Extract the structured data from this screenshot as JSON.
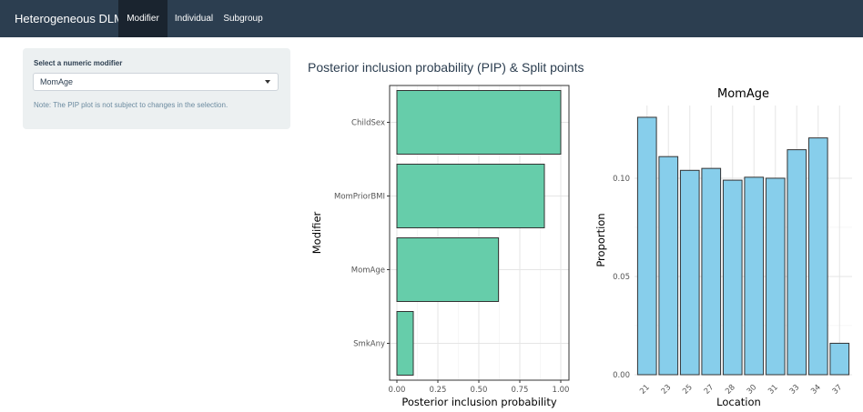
{
  "navbar": {
    "brand": "Heterogeneous DLM",
    "tabs": [
      {
        "label": "Modifier",
        "active": true
      },
      {
        "label": "Individual",
        "active": false
      },
      {
        "label": "Subgroup",
        "active": false
      }
    ]
  },
  "sidebar": {
    "select_label": "Select a numeric modifier",
    "selected_value": "MomAge",
    "note": "Note: The PIP plot is not subject to changes in the selection."
  },
  "main": {
    "title": "Posterior inclusion probability (PIP) & Split points"
  },
  "colors": {
    "navbar": "#2c3e50",
    "pip_bar": "#66cdaa",
    "split_bar": "#87ceeb"
  },
  "chart_data": [
    {
      "type": "bar",
      "orientation": "horizontal",
      "categories": [
        "ChildSex",
        "MomPriorBMI",
        "MomAge",
        "SmkAny"
      ],
      "values": [
        1.0,
        0.9,
        0.62,
        0.1
      ],
      "xlabel": "Posterior inclusion probability",
      "ylabel": "Modifier",
      "xlim": [
        0,
        1
      ],
      "xticks": [
        "0.00",
        "0.25",
        "0.50",
        "0.75",
        "1.00"
      ],
      "grid": true
    },
    {
      "type": "bar",
      "title": "MomAge",
      "categories": [
        "21",
        "23",
        "25",
        "27",
        "28",
        "30",
        "31",
        "33",
        "34",
        "37"
      ],
      "values": [
        0.131,
        0.111,
        0.104,
        0.105,
        0.099,
        0.1005,
        0.1,
        0.1145,
        0.1205,
        0.016
      ],
      "xlabel": "Location",
      "ylabel": "Proportion",
      "ylim": [
        0,
        0.137
      ],
      "yticks": [
        "0.00",
        "0.05",
        "0.10"
      ],
      "grid": true
    }
  ]
}
